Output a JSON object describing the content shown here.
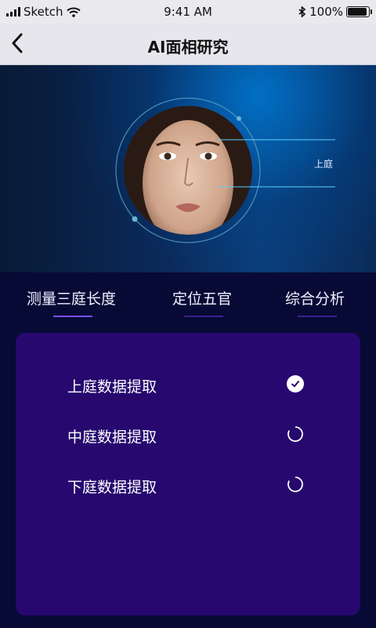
{
  "status_bar": {
    "carrier": "Sketch",
    "time": "9:41 AM",
    "battery": "100%"
  },
  "nav": {
    "title": "AI面相研究"
  },
  "hero": {
    "label": "上庭"
  },
  "tabs": [
    {
      "label": "测量三庭长度"
    },
    {
      "label": "定位五官"
    },
    {
      "label": "综合分析"
    }
  ],
  "tasks": [
    {
      "label": "上庭数据提取",
      "status": "done"
    },
    {
      "label": "中庭数据提取",
      "status": "loading"
    },
    {
      "label": "下庭数据提取",
      "status": "loading"
    }
  ],
  "colors": {
    "accent": "#7b4dff",
    "panel": "#26086f",
    "background": "#070a35",
    "guide_line": "#5fd0ff"
  }
}
